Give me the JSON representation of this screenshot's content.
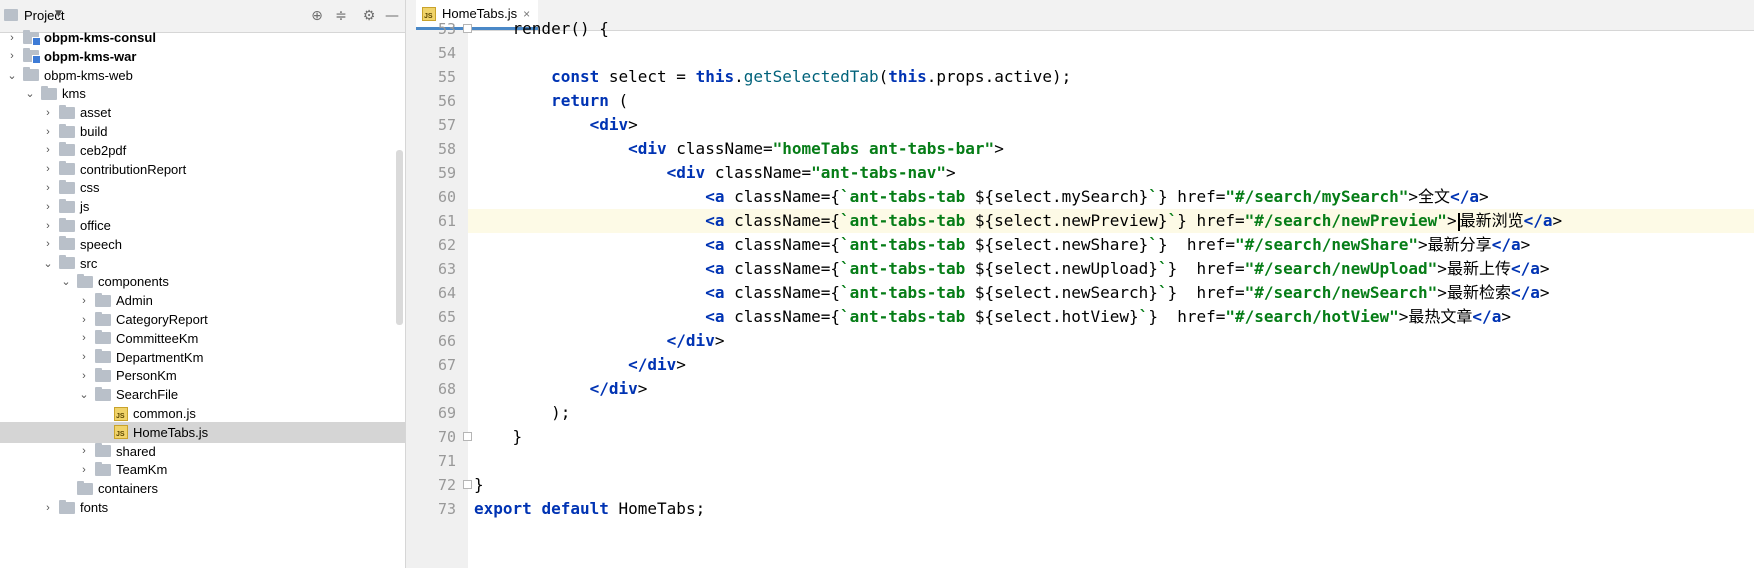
{
  "project_panel": {
    "title": "Project",
    "icons": [
      "target-icon",
      "collapse-icon",
      "gear-icon",
      "minimize-icon"
    ],
    "tree": [
      {
        "label": "obpm-kms-consul",
        "expanded": false,
        "type": "module"
      },
      {
        "label": "obpm-kms-war",
        "expanded": false,
        "type": "module"
      },
      {
        "label": "obpm-kms-web",
        "expanded": true,
        "type": "folder"
      },
      {
        "label": "kms",
        "expanded": true,
        "type": "folder"
      },
      {
        "label": "asset",
        "expanded": false,
        "type": "folder"
      },
      {
        "label": "build",
        "expanded": false,
        "type": "folder"
      },
      {
        "label": "ceb2pdf",
        "expanded": false,
        "type": "folder"
      },
      {
        "label": "contributionReport",
        "expanded": false,
        "type": "folder"
      },
      {
        "label": "css",
        "expanded": false,
        "type": "folder"
      },
      {
        "label": "js",
        "expanded": false,
        "type": "folder"
      },
      {
        "label": "office",
        "expanded": false,
        "type": "folder"
      },
      {
        "label": "speech",
        "expanded": false,
        "type": "folder"
      },
      {
        "label": "src",
        "expanded": true,
        "type": "folder"
      },
      {
        "label": "components",
        "expanded": true,
        "type": "folder"
      },
      {
        "label": "Admin",
        "expanded": false,
        "type": "folder"
      },
      {
        "label": "CategoryReport",
        "expanded": false,
        "type": "folder"
      },
      {
        "label": "CommitteeKm",
        "expanded": false,
        "type": "folder"
      },
      {
        "label": "DepartmentKm",
        "expanded": false,
        "type": "folder"
      },
      {
        "label": "PersonKm",
        "expanded": false,
        "type": "folder"
      },
      {
        "label": "SearchFile",
        "expanded": true,
        "type": "folder"
      },
      {
        "label": "common.js",
        "type": "js"
      },
      {
        "label": "HomeTabs.js",
        "type": "js",
        "selected": true
      },
      {
        "label": "shared",
        "expanded": false,
        "type": "folder"
      },
      {
        "label": "TeamKm",
        "expanded": false,
        "type": "folder"
      },
      {
        "label": "containers",
        "type": "folder"
      },
      {
        "label": "fonts",
        "expanded": false,
        "type": "folder"
      }
    ]
  },
  "editor": {
    "tab_label": "HomeTabs.js",
    "lines": [
      {
        "num": "53",
        "text": "    render() {"
      },
      {
        "num": "54",
        "text": ""
      },
      {
        "num": "55",
        "text": "        const select = this.getSelectedTab(this.props.active);"
      },
      {
        "num": "56",
        "text": "        return ("
      },
      {
        "num": "57",
        "text": "            <div>"
      },
      {
        "num": "58",
        "text": "                <div className=\"homeTabs ant-tabs-bar\">"
      },
      {
        "num": "59",
        "text": "                    <div className=\"ant-tabs-nav\">"
      },
      {
        "num": "60",
        "text": "                        <a className={`ant-tabs-tab ${select.mySearch}`} href=\"#/search/mySearch\">全文</a>"
      },
      {
        "num": "61",
        "text": "                        <a className={`ant-tabs-tab ${select.newPreview}`} href=\"#/search/newPreview\">最新浏览</a>"
      },
      {
        "num": "62",
        "text": "                        <a className={`ant-tabs-tab ${select.newShare}`}  href=\"#/search/newShare\">最新分享</a>"
      },
      {
        "num": "63",
        "text": "                        <a className={`ant-tabs-tab ${select.newUpload}`}  href=\"#/search/newUpload\">最新上传</a>"
      },
      {
        "num": "64",
        "text": "                        <a className={`ant-tabs-tab ${select.newSearch}`}  href=\"#/search/newSearch\">最新检索</a>"
      },
      {
        "num": "65",
        "text": "                        <a className={`ant-tabs-tab ${select.hotView}`}  href=\"#/search/hotView\">最热文章</a>"
      },
      {
        "num": "66",
        "text": "                    </div>"
      },
      {
        "num": "67",
        "text": "                </div>"
      },
      {
        "num": "68",
        "text": "            </div>"
      },
      {
        "num": "69",
        "text": "        );"
      },
      {
        "num": "70",
        "text": "    }"
      },
      {
        "num": "71",
        "text": ""
      },
      {
        "num": "72",
        "text": "}"
      },
      {
        "num": "73",
        "text": "export default HomeTabs;"
      }
    ],
    "current_line": "61"
  },
  "annotation": {
    "color": "#e8262f"
  }
}
